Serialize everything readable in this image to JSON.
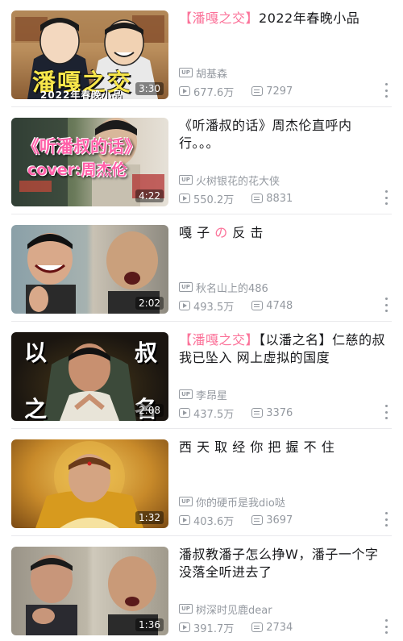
{
  "videos": [
    {
      "title_highlight": "【潘嘎之交】",
      "title_rest": "2022年春晚小品",
      "uploader": "胡基森",
      "views": "677.6万",
      "danmaku": "7297",
      "duration": "3:30",
      "thumb_text_1": "潘嘎之交",
      "thumb_text_2": "2022年春晚小品"
    },
    {
      "title_highlight": "",
      "title_rest": "《听潘叔的话》周杰伦直呼内行。。。",
      "uploader": "火树银花的花大侠",
      "views": "550.2万",
      "danmaku": "8831",
      "duration": "4:22",
      "thumb_text_1": "《听潘叔的话》",
      "thumb_text_2": "cover:周杰伦"
    },
    {
      "title_pre": "嘎 子 ",
      "title_highlight": "の",
      "title_rest": " 反 击",
      "uploader": "秋名山上的486",
      "views": "493.5万",
      "danmaku": "4748",
      "duration": "2:02"
    },
    {
      "title_highlight": "【潘嘎之交】",
      "title_rest": "【以潘之名】仁慈的叔我已坠入 网上虚拟的国度",
      "uploader": "李昂星",
      "views": "437.5万",
      "danmaku": "3376",
      "duration": "2:08",
      "thumb_chars": [
        "以",
        "叔",
        "之",
        "名"
      ]
    },
    {
      "title_highlight": "",
      "title_rest": "西 天 取 经 你 把 握 不 住",
      "uploader": "你的硬币是我dio哒",
      "views": "403.6万",
      "danmaku": "3697",
      "duration": "1:32"
    },
    {
      "title_highlight": "",
      "title_rest": "潘叔教潘子怎么挣W，潘子一个字没落全听进去了",
      "uploader": "树深时见鹿dear",
      "views": "391.7万",
      "danmaku": "2734",
      "duration": "1:36"
    }
  ],
  "labels": {
    "up_badge": "UP"
  },
  "colors": {
    "accent": "#fb7299",
    "muted": "#9499a0",
    "text": "#18191c"
  },
  "icons": [
    "play-count-icon",
    "danmaku-icon",
    "more-icon",
    "up-badge-icon"
  ]
}
